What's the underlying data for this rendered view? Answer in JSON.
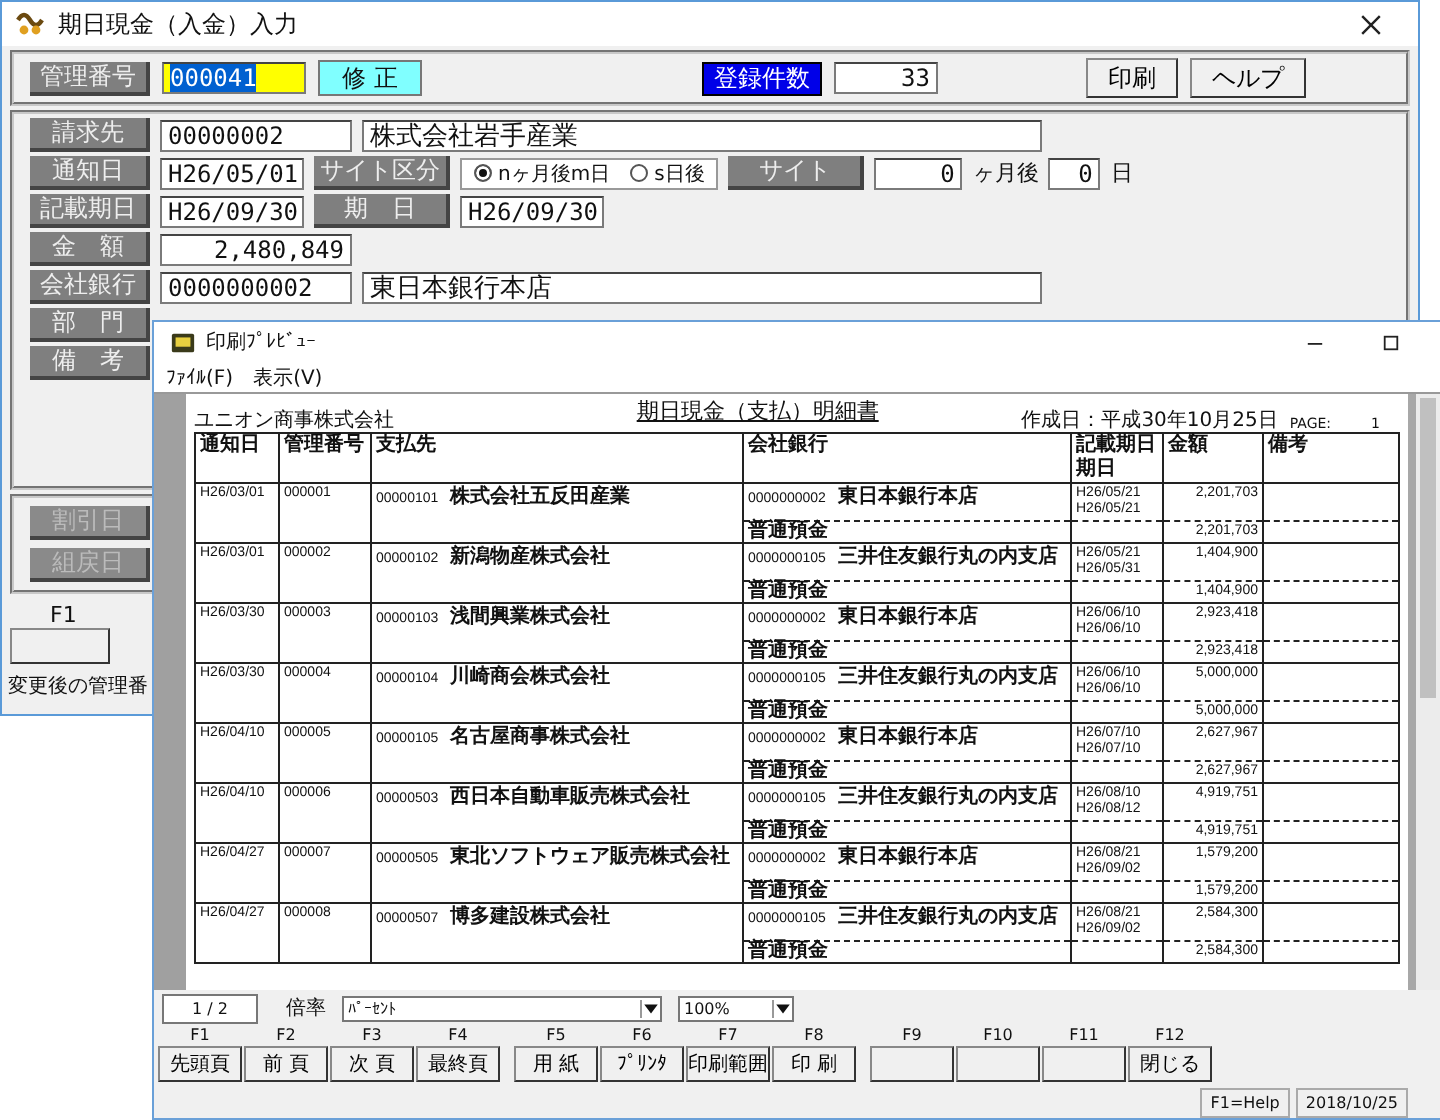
{
  "entry_window": {
    "title": "期日現金（入金）入力",
    "header": {
      "id_label": "管理番号",
      "id_value": "000041",
      "id_selected": true,
      "mode": "修 正",
      "count_label": "登録件数",
      "count": "33",
      "buttons": [
        "印刷",
        "ヘルプ"
      ]
    },
    "fields": [
      {
        "kind": "code_name",
        "label": "請求先",
        "code": "00000002",
        "value": "株式会社岩手産業"
      },
      {
        "kind": "notice",
        "label": "通知日",
        "value": "H26/05/01",
        "label2": "サイト区分",
        "radios": [
          {
            "label": "nヶ月後m日",
            "selected": true
          },
          {
            "label": "s日後",
            "selected": false
          }
        ],
        "label3": "サイト",
        "months": "0",
        "months_unit": "ヶ月後",
        "days": "0",
        "days_unit": "日"
      },
      {
        "kind": "dates",
        "label": "記載期日",
        "value": "H26/09/30",
        "label2": "期　日",
        "value2": "H26/09/30"
      },
      {
        "kind": "amount",
        "label": "金　額",
        "value": "2,480,849"
      },
      {
        "kind": "code_name",
        "label": "会社銀行",
        "code": "0000000002",
        "value": "東日本銀行本店"
      },
      {
        "kind": "label",
        "label": "部　門"
      },
      {
        "kind": "label",
        "label": "備　考"
      }
    ],
    "lower_fields": [
      "割引日",
      "組戻日"
    ],
    "fkey": "F1",
    "status": "変更後の管理番"
  },
  "preview_window": {
    "title": "印刷ﾌﾟﾚﾋﾞｭｰ",
    "menu": [
      "ﾌｧｲﾙ(F)",
      "表示(V)"
    ],
    "report": {
      "company": "ユニオン商事株式会社",
      "title": "期日現金（支払）明細書",
      "created": "作成日：平成30年10月25日",
      "page_label": "PAGE:",
      "page": "1",
      "columns": [
        {
          "label": "通知日"
        },
        {
          "label": "管理番号"
        },
        {
          "label": "支払先"
        },
        {
          "label": "会社銀行"
        },
        {
          "label": "記載期日",
          "sublabel": "期日"
        },
        {
          "label": "金額"
        },
        {
          "label": "備考"
        }
      ],
      "rows": [
        {
          "date": "H26/03/01",
          "number": "000001",
          "payee_code": "00000101",
          "payee": "株式会社五反田産業",
          "bank_code": "0000000002",
          "bank": "東日本銀行本店",
          "entry_date": "H26/05/21",
          "due_date": "H26/05/21",
          "amount": "2,201,703",
          "method": "普通預金",
          "total": "2,201,703"
        },
        {
          "date": "H26/03/01",
          "number": "000002",
          "payee_code": "00000102",
          "payee": "新潟物産株式会社",
          "bank_code": "0000000105",
          "bank": "三井住友銀行丸の内支店",
          "entry_date": "H26/05/21",
          "due_date": "H26/05/31",
          "amount": "1,404,900",
          "method": "普通預金",
          "total": "1,404,900"
        },
        {
          "date": "H26/03/30",
          "number": "000003",
          "payee_code": "00000103",
          "payee": "浅間興業株式会社",
          "bank_code": "0000000002",
          "bank": "東日本銀行本店",
          "entry_date": "H26/06/10",
          "due_date": "H26/06/10",
          "amount": "2,923,418",
          "method": "普通預金",
          "total": "2,923,418"
        },
        {
          "date": "H26/03/30",
          "number": "000004",
          "payee_code": "00000104",
          "payee": "川崎商会株式会社",
          "bank_code": "0000000105",
          "bank": "三井住友銀行丸の内支店",
          "entry_date": "H26/06/10",
          "due_date": "H26/06/10",
          "amount": "5,000,000",
          "method": "普通預金",
          "total": "5,000,000"
        },
        {
          "date": "H26/04/10",
          "number": "000005",
          "payee_code": "00000105",
          "payee": "名古屋商事株式会社",
          "bank_code": "0000000002",
          "bank": "東日本銀行本店",
          "entry_date": "H26/07/10",
          "due_date": "H26/07/10",
          "amount": "2,627,967",
          "method": "普通預金",
          "total": "2,627,967"
        },
        {
          "date": "H26/04/10",
          "number": "000006",
          "payee_code": "00000503",
          "payee": "西日本自動車販売株式会社",
          "bank_code": "0000000105",
          "bank": "三井住友銀行丸の内支店",
          "entry_date": "H26/08/10",
          "due_date": "H26/08/12",
          "amount": "4,919,751",
          "method": "普通預金",
          "total": "4,919,751"
        },
        {
          "date": "H26/04/27",
          "number": "000007",
          "payee_code": "00000505",
          "payee": "東北ソフトウェア販売株式会社",
          "bank_code": "0000000002",
          "bank": "東日本銀行本店",
          "entry_date": "H26/08/21",
          "due_date": "H26/09/02",
          "amount": "1,579,200",
          "method": "普通預金",
          "total": "1,579,200"
        },
        {
          "date": "H26/04/27",
          "number": "000008",
          "payee_code": "00000507",
          "payee": "博多建設株式会社",
          "bank_code": "0000000105",
          "bank": "三井住友銀行丸の内支店",
          "entry_date": "H26/08/21",
          "due_date": "H26/09/02",
          "amount": "2,584,300",
          "method": "普通預金",
          "total": "2,584,300"
        }
      ]
    },
    "pager": "1 / 2",
    "zoom_label": "倍率",
    "zoom_mode": "ﾊﾟｰｾﾝﾄ",
    "zoom": "100%",
    "fkeys": [
      {
        "key": "F1",
        "label": "先頭頁"
      },
      {
        "key": "F2",
        "label": "前 頁"
      },
      {
        "key": "F3",
        "label": "次 頁"
      },
      {
        "key": "F4",
        "label": "最終頁"
      },
      {
        "key": "F5",
        "label": "用 紙"
      },
      {
        "key": "F6",
        "label": "ﾌﾟﾘﾝﾀ"
      },
      {
        "key": "F7",
        "label": "印刷範囲"
      },
      {
        "key": "F8",
        "label": "印 刷"
      },
      {
        "key": "F9"
      },
      {
        "key": "F10"
      },
      {
        "key": "F11"
      },
      {
        "key": "F12",
        "label": "閉じる"
      }
    ],
    "status": [
      "F1=Help",
      "2018/10/25"
    ]
  }
}
